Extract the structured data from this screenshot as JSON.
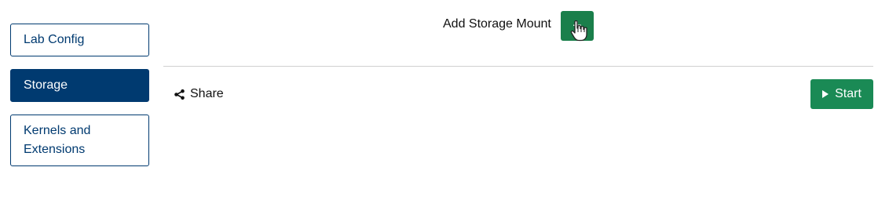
{
  "sidebar": {
    "items": [
      {
        "label": "Lab Config",
        "active": false
      },
      {
        "label": "Storage",
        "active": true
      },
      {
        "label": "Kernels and Extensions",
        "active": false
      }
    ]
  },
  "storage": {
    "add_mount_label": "Add Storage Mount",
    "add_mount_button_glyph": "+"
  },
  "footer": {
    "share_label": "Share",
    "start_label": "Start"
  },
  "icons": {
    "add_button": "plus-icon",
    "cursor": "hand-pointer-icon",
    "share": "share-icon",
    "start": "play-icon"
  },
  "colors": {
    "primary_navy": "#003a70",
    "button_green": "#1a8a55",
    "divider": "#cfcfcf"
  }
}
